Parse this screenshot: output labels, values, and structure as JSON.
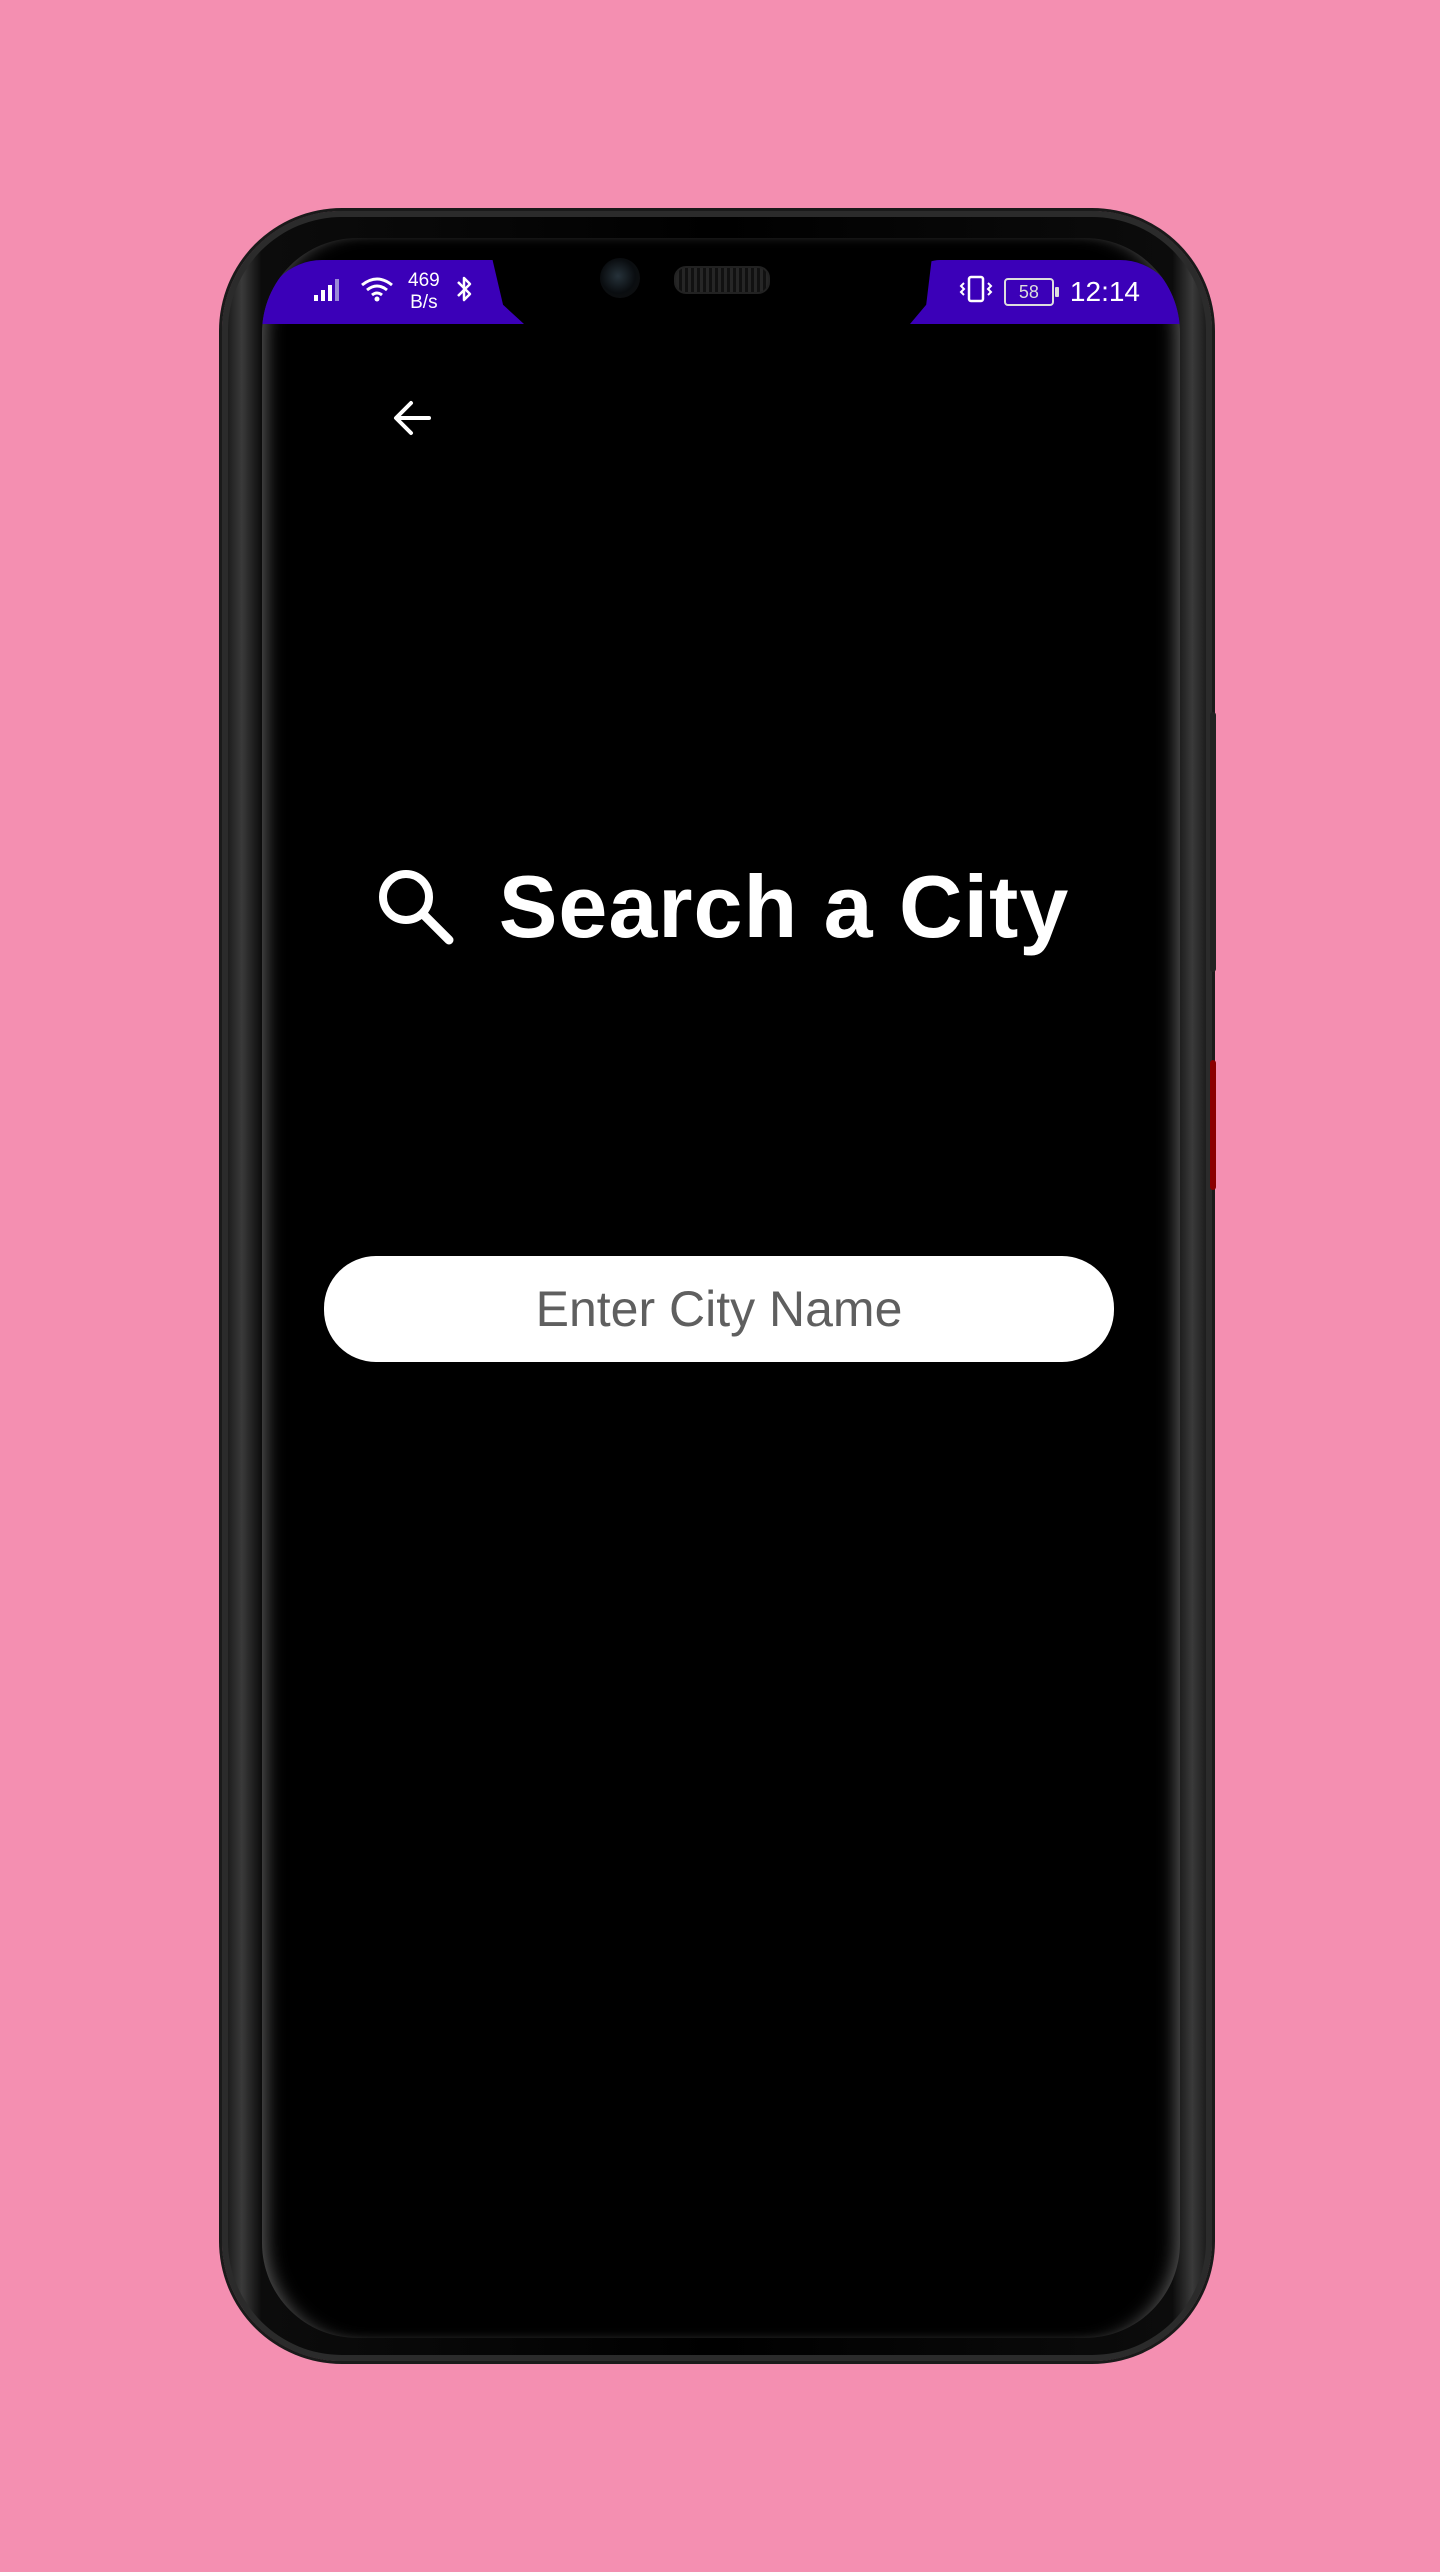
{
  "status_bar": {
    "net_speed_value": "469",
    "net_speed_unit": "B/s",
    "battery_level": "58",
    "time": "12:14"
  },
  "page": {
    "title": "Search a City"
  },
  "search": {
    "placeholder": "Enter City Name",
    "value": ""
  },
  "colors": {
    "background": "#f48fb1",
    "status_bar": "#3b00b8",
    "screen": "#000000",
    "input_fill": "#ffffff",
    "placeholder_text": "#5f5f5f"
  },
  "icons": {
    "back": "arrow-left-icon",
    "search": "search-icon",
    "signal": "signal-icon",
    "wifi": "wifi-icon",
    "bluetooth": "bluetooth-icon",
    "vibrate": "vibrate-icon",
    "battery": "battery-icon"
  }
}
